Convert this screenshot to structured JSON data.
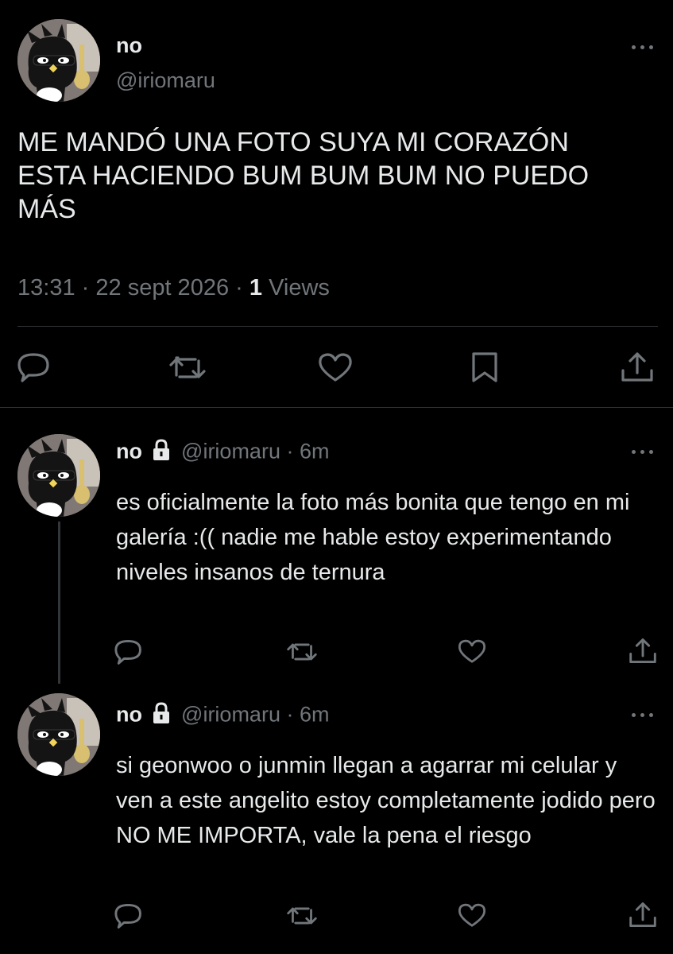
{
  "main_tweet": {
    "display_name": "no",
    "handle": "@iriomaru",
    "text": "ME MANDÓ UNA FOTO SUYA MI CORAZÓN ESTA HACIENDO BUM BUM BUM NO PUEDO MÁS",
    "time": "13:31",
    "separator": "·",
    "date": "22 sept 2026",
    "views_count": "1",
    "views_label": "Views"
  },
  "replies": [
    {
      "display_name": "no",
      "handle": "@iriomaru",
      "separator": "·",
      "age": "6m",
      "text": "es oficialmente la foto más bonita que tengo en mi galería :(( nadie me hable estoy experimentando niveles insanos de ternura"
    },
    {
      "display_name": "no",
      "handle": "@iriomaru",
      "separator": "·",
      "age": "6m",
      "text": "si geonwoo o junmin llegan a agarrar mi celular y ven a este angelito estoy completamente jodido pero NO ME IMPORTA, vale la pena el riesgo"
    }
  ],
  "icons": [
    "more-icon",
    "reply-icon",
    "retweet-icon",
    "like-icon",
    "bookmark-icon",
    "share-icon",
    "lock-icon"
  ],
  "colors": {
    "background": "#000000",
    "text": "#e7e9ea",
    "muted": "#71767b",
    "divider": "#2f3336"
  }
}
